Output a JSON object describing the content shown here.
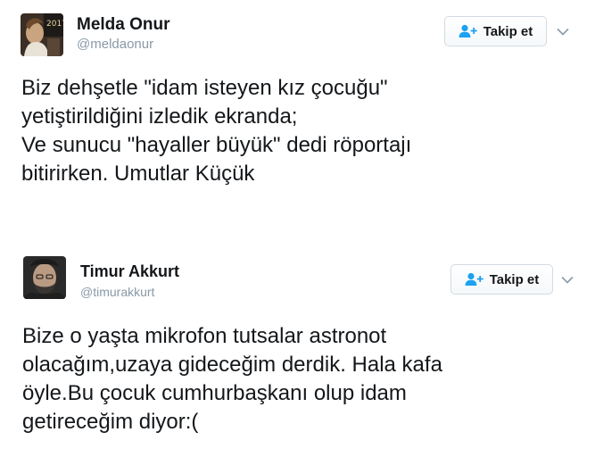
{
  "tweets": [
    {
      "author": {
        "name": "Melda Onur",
        "handle": "@meldaonur"
      },
      "follow_label": "Takip et",
      "text_lines": [
        "Biz dehşetle \"idam isteyen kız çocuğu\"",
        "yetiştirildiğini izledik ekranda;",
        "Ve sunucu \"hayaller büyük\" dedi röportajı",
        "bitirirken. Umutlar Küçük"
      ]
    },
    {
      "author": {
        "name": "Timur Akkurt",
        "handle": "@timurakkurt"
      },
      "follow_label": "Takip et",
      "text_lines": [
        "Bize o yaşta mikrofon tutsalar astronot",
        "olacağım,uzaya gideceğim derdik. Hala kafa",
        "öyle.Bu çocuk cumhurbaşkanı olup idam",
        "getireceğim diyor:("
      ]
    }
  ],
  "colors": {
    "text": "#14171a",
    "handle": "#8899a6",
    "follow_icon": "#1da1f2",
    "button_border": "#d4dbe1",
    "caret": "#8899a6"
  },
  "icons": {
    "follow": "person-add-icon",
    "more": "chevron-down-icon"
  }
}
